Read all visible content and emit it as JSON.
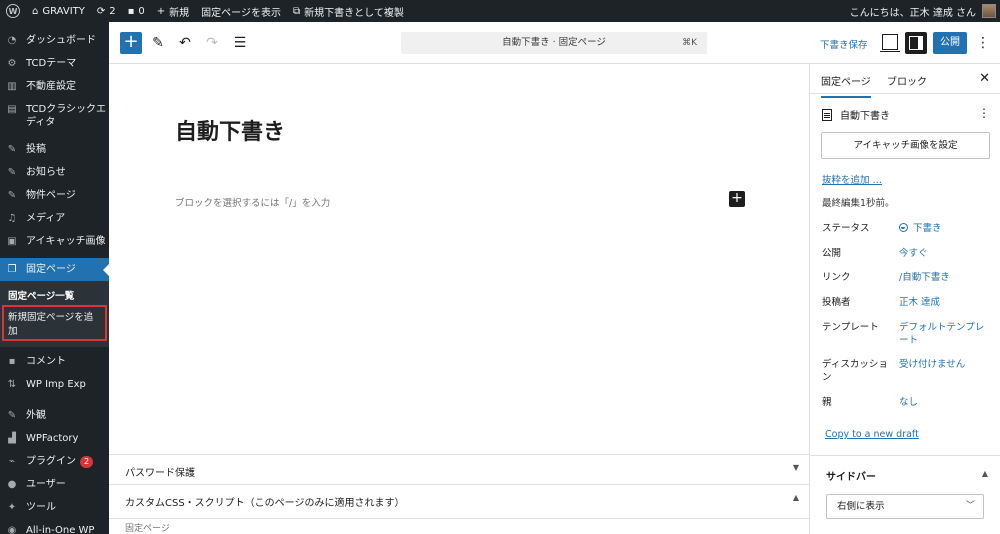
{
  "admin_bar": {
    "site_name": "GRAVITY",
    "updates_count": "2",
    "comments_count": "0",
    "new_label": "新規",
    "view_page_label": "固定ページを表示",
    "duplicate_label": "新規下書きとして複製",
    "greeting": "こんにちは、正木 達成 さん"
  },
  "menu": {
    "items": [
      {
        "label": "ダッシュボード",
        "icon": "dashboard-icon"
      },
      {
        "label": "TCDテーマ",
        "icon": "gear-icon"
      },
      {
        "label": "不動産設定",
        "icon": "building-icon"
      },
      {
        "label": "TCDクラシックエディタ",
        "icon": "editor-icon"
      },
      {
        "label": "投稿",
        "icon": "pin-icon"
      },
      {
        "label": "お知らせ",
        "icon": "pin-icon"
      },
      {
        "label": "物件ページ",
        "icon": "pin-icon"
      },
      {
        "label": "メディア",
        "icon": "media-icon"
      },
      {
        "label": "アイキャッチ画像",
        "icon": "image-icon"
      },
      {
        "label": "固定ページ",
        "icon": "pages-icon"
      }
    ],
    "submenu": [
      "固定ページ一覧",
      "新規固定ページを追加"
    ],
    "items_after": [
      {
        "label": "コメント",
        "icon": "comment-icon"
      },
      {
        "label": "WP Imp Exp",
        "icon": "import-export-icon"
      },
      {
        "label": "外観",
        "icon": "brush-icon"
      },
      {
        "label": "WPFactory",
        "icon": "factory-icon"
      },
      {
        "label": "プラグイン",
        "icon": "plugin-icon",
        "badge": "2"
      },
      {
        "label": "ユーザー",
        "icon": "user-icon"
      },
      {
        "label": "ツール",
        "icon": "wrench-icon"
      },
      {
        "label": "All-in-One WP Migration",
        "icon": "migration-icon"
      }
    ]
  },
  "toolbar": {
    "document_title": "自動下書き · 固定ページ",
    "shortcut": "⌘K",
    "save_draft_label": "下書き保存",
    "publish_label": "公開"
  },
  "editor": {
    "post_title": "自動下書き",
    "block_placeholder": "ブロックを選択するには「/」を入力"
  },
  "metaboxes": {
    "password": "パスワード保護",
    "custom_css": "カスタムCSS・スクリプト（このページのみに適用されます）",
    "footer_crumb": "固定ページ"
  },
  "sidebar": {
    "tab_page": "固定ページ",
    "tab_block": "ブロック",
    "doc_title": "自動下書き",
    "featured_image_button": "アイキャッチ画像を設定",
    "add_excerpt": "抜粋を追加 …",
    "last_edited": "最終編集1秒前。",
    "rows": [
      {
        "key": "ステータス",
        "value": "下書き"
      },
      {
        "key": "公開",
        "value": "今すぐ"
      },
      {
        "key": "リンク",
        "value": "/自動下書き"
      },
      {
        "key": "投稿者",
        "value": "正木 達成"
      },
      {
        "key": "テンプレート",
        "value": "デフォルトテンプレート"
      },
      {
        "key": "ディスカッション",
        "value": "受け付けません"
      },
      {
        "key": "親",
        "value": "なし"
      }
    ],
    "copy_draft": "Copy to a new draft",
    "panel_title": "サイドバー",
    "panel_select_value": "右側に表示"
  },
  "colors": {
    "accent": "#2271b1",
    "admin_dark": "#1d2327",
    "badge": "#d63638"
  }
}
